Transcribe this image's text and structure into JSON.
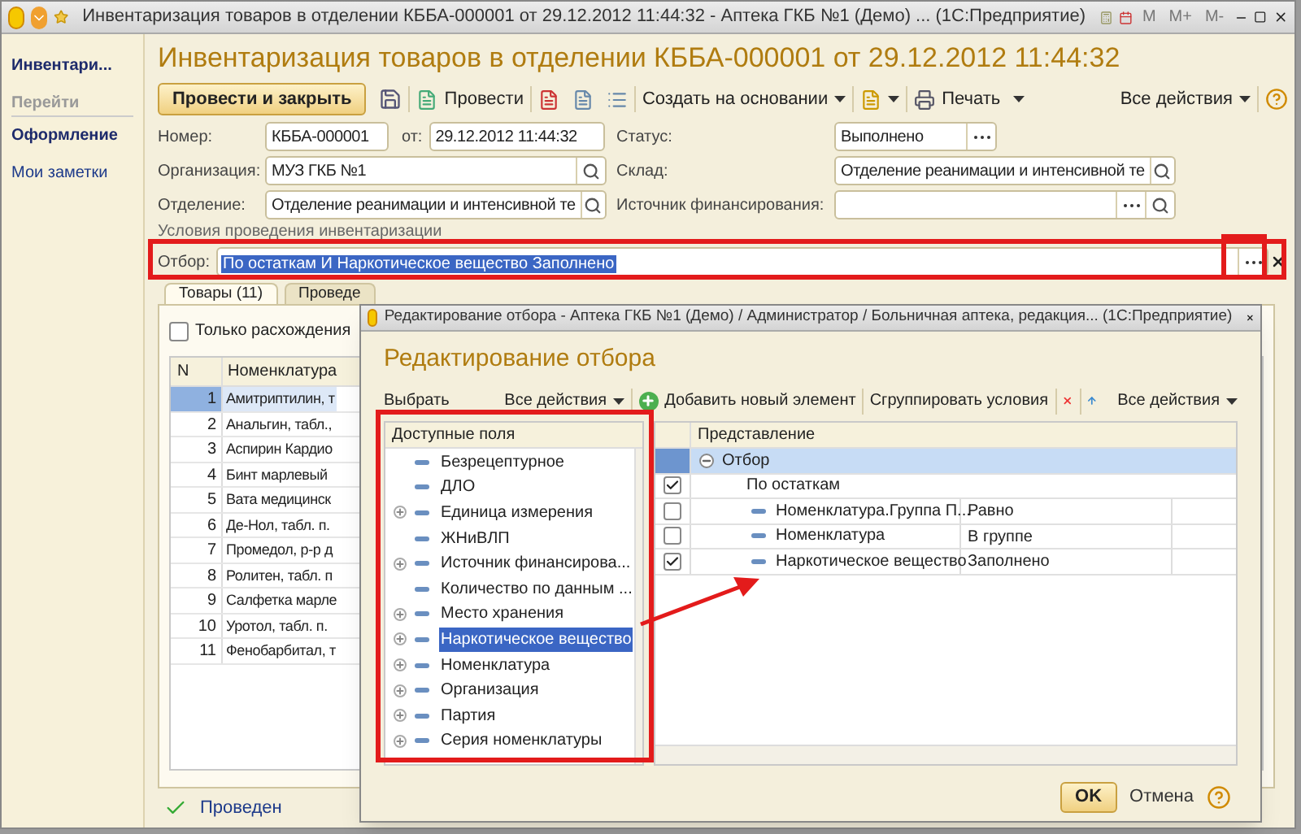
{
  "window": {
    "title": "Инвентаризация товаров в отделении КББА-000001 от 29.12.2012 11:44:32 - Аптека ГКБ №1 (Демо) ... (1С:Предприятие)",
    "calc_buttons": [
      "M",
      "M+",
      "M-"
    ]
  },
  "sidebar": {
    "title": "Инвентари...",
    "section": "Перейти",
    "items": [
      {
        "label": "Оформление",
        "selected": true
      },
      {
        "label": "Мои заметки",
        "selected": false
      }
    ]
  },
  "form": {
    "heading": "Инвентаризация товаров в отделении КББА-000001 от 29.12.2012 11:44:32",
    "toolbar": {
      "primary": "Провести и закрыть",
      "post": "Провести",
      "create_based": "Создать на основании",
      "print": "Печать",
      "all_actions": "Все действия"
    },
    "number": {
      "label": "Номер:",
      "value": "КББА-000001"
    },
    "date": {
      "label": "от:",
      "value": "29.12.2012 11:44:32"
    },
    "organization": {
      "label": "Организация:",
      "value": "МУЗ ГКБ №1"
    },
    "department": {
      "label": "Отделение:",
      "value": "Отделение реанимации и интенсивной те"
    },
    "status": {
      "label": "Статус:",
      "value": "Выполнено"
    },
    "warehouse": {
      "label": "Склад:",
      "value": "Отделение реанимации и интенсивной те"
    },
    "funding": {
      "label": "Источник финансирования:"
    },
    "conditions": {
      "title": "Условия проведения инвентаризации",
      "filter_label": "Отбор:",
      "filter_value": "По остаткам И Наркотическое вещество Заполнено"
    },
    "tabs": [
      {
        "label": "Товары (11)",
        "selected": true
      },
      {
        "label": "Проведе",
        "selected": false
      }
    ],
    "only_differences": {
      "label": "Только расхождения",
      "checked": false
    },
    "table": {
      "columns": [
        "N",
        "Номенклатура"
      ],
      "rows": [
        {
          "n": "1",
          "name": "Амитриптилин, т",
          "selected": true
        },
        {
          "n": "2",
          "name": "Анальгин, табл.,",
          "selected": false
        },
        {
          "n": "3",
          "name": "Аспирин Кардио",
          "selected": false
        },
        {
          "n": "4",
          "name": "Бинт марлевый",
          "selected": false
        },
        {
          "n": "5",
          "name": "Вата медицинск",
          "selected": false
        },
        {
          "n": "6",
          "name": "Де-Нол, табл. п.",
          "selected": false
        },
        {
          "n": "7",
          "name": "Промедол, р-р д",
          "selected": false
        },
        {
          "n": "8",
          "name": "Ролитен, табл. п",
          "selected": false
        },
        {
          "n": "9",
          "name": "Салфетка марле",
          "selected": false
        },
        {
          "n": "10",
          "name": "Уротол, табл. п.",
          "selected": false
        },
        {
          "n": "11",
          "name": "Фенобарбитал, т",
          "selected": false
        }
      ]
    },
    "posted": {
      "label": "Проведен"
    }
  },
  "dialog": {
    "title": "Редактирование отбора - Аптека ГКБ №1 (Демо) / Администратор /  Больничная аптека, редакция... (1С:Предприятие)",
    "heading": "Редактирование отбора",
    "toolbar": {
      "select": "Выбрать",
      "all_actions": "Все действия",
      "add": "Добавить новый элемент",
      "group": "Сгруппировать условия",
      "all_actions_2": "Все действия"
    },
    "fields_panel": {
      "title": "Доступные поля",
      "items": [
        {
          "label": "Безрецептурное",
          "expandable": false,
          "selected": false
        },
        {
          "label": "ДЛО",
          "expandable": false,
          "selected": false
        },
        {
          "label": "Единица измерения",
          "expandable": true,
          "selected": false
        },
        {
          "label": "ЖНиВЛП",
          "expandable": false,
          "selected": false
        },
        {
          "label": "Источник финансирова...",
          "expandable": true,
          "selected": false
        },
        {
          "label": "Количество по данным ...",
          "expandable": false,
          "selected": false
        },
        {
          "label": "Место хранения",
          "expandable": true,
          "selected": false
        },
        {
          "label": "Наркотическое вещество",
          "expandable": true,
          "selected": true
        },
        {
          "label": "Номенклатура",
          "expandable": true,
          "selected": false
        },
        {
          "label": "Организация",
          "expandable": true,
          "selected": false
        },
        {
          "label": "Партия",
          "expandable": true,
          "selected": false
        },
        {
          "label": "Серия номенклатуры",
          "expandable": true,
          "selected": false
        }
      ]
    },
    "filter_table": {
      "column": "Представление",
      "root": {
        "label": "Отбор",
        "expanded": true,
        "selected": true,
        "children": [
          {
            "kind": "group",
            "label": "По остаткам",
            "checked": true
          },
          {
            "kind": "condition",
            "label": "Номенклатура.Группа П...",
            "comparison": "Равно",
            "checked": false
          },
          {
            "kind": "condition",
            "label": "Номенклатура",
            "comparison": "В группе",
            "checked": false
          },
          {
            "kind": "condition",
            "label": "Наркотическое вещество",
            "comparison": "Заполнено",
            "checked": true
          }
        ]
      }
    },
    "ok": "OK",
    "cancel": "Отмена"
  }
}
